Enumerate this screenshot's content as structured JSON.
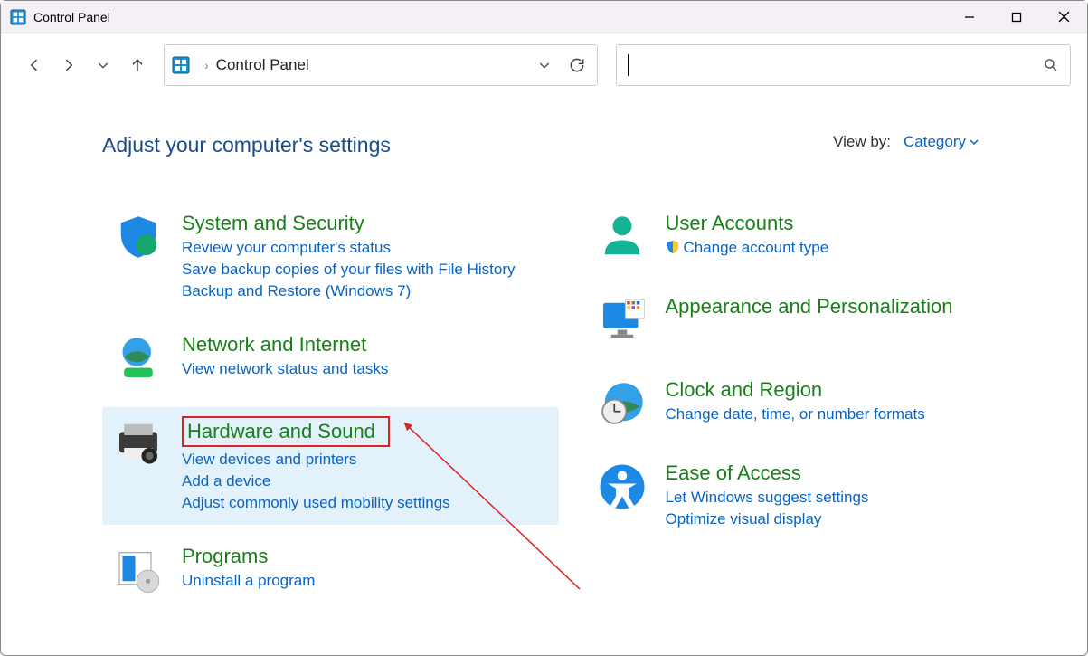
{
  "window": {
    "title": "Control Panel"
  },
  "breadcrumb": {
    "current": "Control Panel"
  },
  "header": {
    "title": "Adjust your computer's settings",
    "viewby_label": "View by:",
    "viewby_value": "Category"
  },
  "columns": [
    [
      {
        "icon": "shield",
        "title": "System and Security",
        "links": [
          "Review your computer's status",
          "Save backup copies of your files with File History",
          "Backup and Restore (Windows 7)"
        ]
      },
      {
        "icon": "globe",
        "title": "Network and Internet",
        "links": [
          "View network status and tasks"
        ]
      },
      {
        "icon": "printer",
        "title": "Hardware and Sound",
        "highlight": true,
        "redbox": true,
        "links": [
          "View devices and printers",
          "Add a device",
          "Adjust commonly used mobility settings"
        ]
      },
      {
        "icon": "programs",
        "title": "Programs",
        "links": [
          "Uninstall a program"
        ]
      }
    ],
    [
      {
        "icon": "user",
        "title": "User Accounts",
        "links": [
          "Change account type"
        ],
        "link_shields": [
          true
        ]
      },
      {
        "icon": "monitor",
        "title": "Appearance and Personalization",
        "links": []
      },
      {
        "icon": "clock",
        "title": "Clock and Region",
        "links": [
          "Change date, time, or number formats"
        ]
      },
      {
        "icon": "access",
        "title": "Ease of Access",
        "links": [
          "Let Windows suggest settings",
          "Optimize visual display"
        ]
      }
    ]
  ]
}
